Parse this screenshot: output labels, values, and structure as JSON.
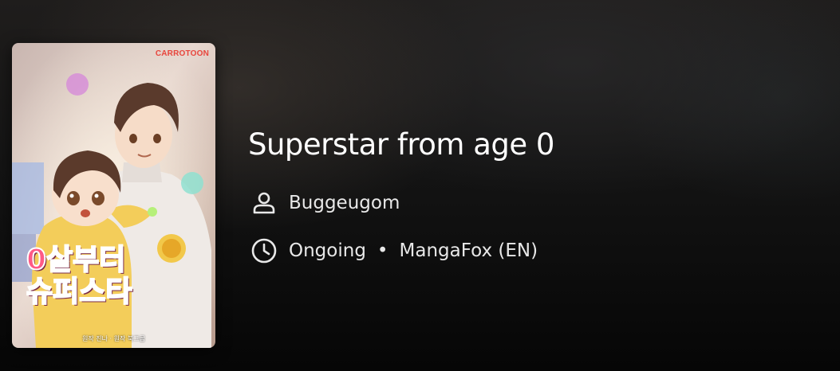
{
  "manga": {
    "title": "Superstar from age 0",
    "author": "Buggeugom",
    "status": "Ongoing",
    "source": "MangaFox (EN)",
    "separator": "•"
  },
  "cover": {
    "brand": "CARROTOON",
    "title": "0살부터\n슈퍼스타",
    "credit": "원작 진나 · 원작 북그곰"
  },
  "icons": {
    "author": "person-icon",
    "status": "clock-icon"
  }
}
